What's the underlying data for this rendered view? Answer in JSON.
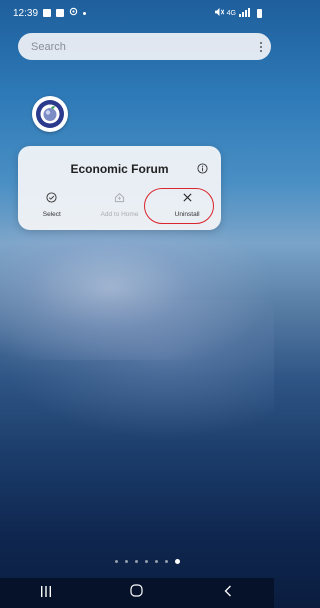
{
  "status_bar": {
    "time": "12:39",
    "right_text": "4G"
  },
  "search": {
    "placeholder": "Search"
  },
  "app": {
    "name": "Economic Forum"
  },
  "popup": {
    "title": "Economic Forum",
    "actions": [
      {
        "label": "Select",
        "icon": "check-circle-icon",
        "enabled": true
      },
      {
        "label": "Add to Home",
        "icon": "home-icon",
        "enabled": false
      },
      {
        "label": "Uninstall",
        "icon": "close-icon",
        "enabled": true,
        "highlighted": true
      }
    ]
  },
  "page_indicator": {
    "count": 7,
    "active_index": 6
  },
  "colors": {
    "highlight": "#d9252d",
    "nav_bar": "#05122a"
  }
}
